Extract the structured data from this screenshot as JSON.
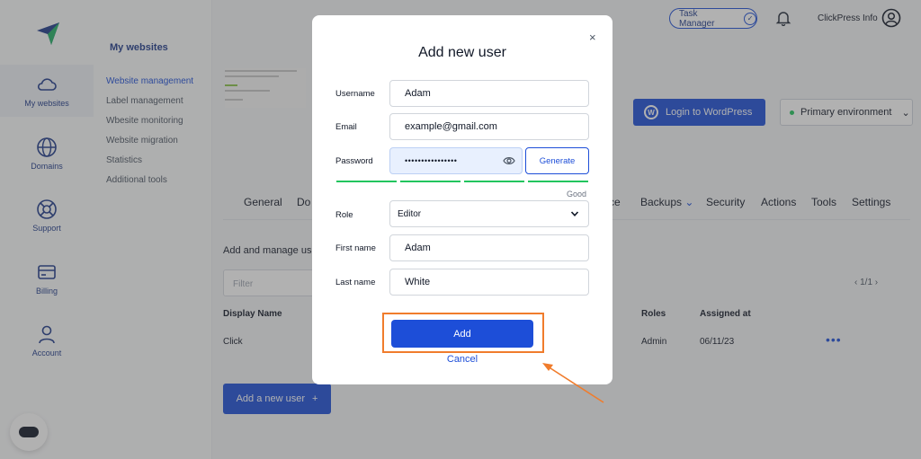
{
  "app": {
    "logo_icon": "paper-plane-logo-icon"
  },
  "rail": {
    "items": [
      {
        "label": "My websites",
        "icon": "cloud-icon"
      },
      {
        "label": "Domains",
        "icon": "globe-icon"
      },
      {
        "label": "Support",
        "icon": "lifebuoy-icon"
      },
      {
        "label": "Billing",
        "icon": "card-icon"
      },
      {
        "label": "Account",
        "icon": "user-icon"
      }
    ]
  },
  "subnav": {
    "title": "My websites",
    "items": [
      "Website management",
      "Label management",
      "Wbesite monitoring",
      "Website migration",
      "Statistics",
      "Additional tools"
    ]
  },
  "topbar": {
    "task_manager": "Task Manager",
    "check": "✓",
    "account_name": "ClickPress Info"
  },
  "site": {
    "login_wp": "Login to WordPress",
    "wp_logo": "W",
    "environment": "Primary environment",
    "env_chevron": "⌄"
  },
  "tabs": [
    "General",
    "Do",
    "ce",
    "Backups",
    "Security",
    "Actions",
    "Tools",
    "Settings"
  ],
  "tab_chevron": "⌄",
  "users": {
    "subtitle": "Add and manage use",
    "filter_placeholder": "Filter",
    "pager": "‹   1/1   ›",
    "columns": {
      "display_name": "Display Name",
      "roles": "Roles",
      "assigned_at": "Assigned at"
    },
    "rows": [
      {
        "display_name": "Click",
        "role": "Admin",
        "assigned_at": "06/11/23",
        "more": "•••"
      }
    ],
    "add_button": "Add a new user",
    "add_plus": "+"
  },
  "modal": {
    "title": "Add new user",
    "close": "×",
    "username_label": "Username",
    "username_value": "Adam",
    "email_label": "Email",
    "email_value": "example@gmail.com",
    "password_label": "Password",
    "password_value": "••••••••••••••••",
    "generate_button": "Generate",
    "strength_label": "Good",
    "strength_level": 4,
    "role_label": "Role",
    "role_value": "Editor",
    "first_name_label": "First name",
    "first_name_value": "Adam",
    "last_name_label": "Last name",
    "last_name_value": "White",
    "add_button": "Add",
    "cancel_link": "Cancel"
  },
  "colors": {
    "accent": "#1d4ed8",
    "highlight": "#f07c2c",
    "success": "#22c55e"
  }
}
